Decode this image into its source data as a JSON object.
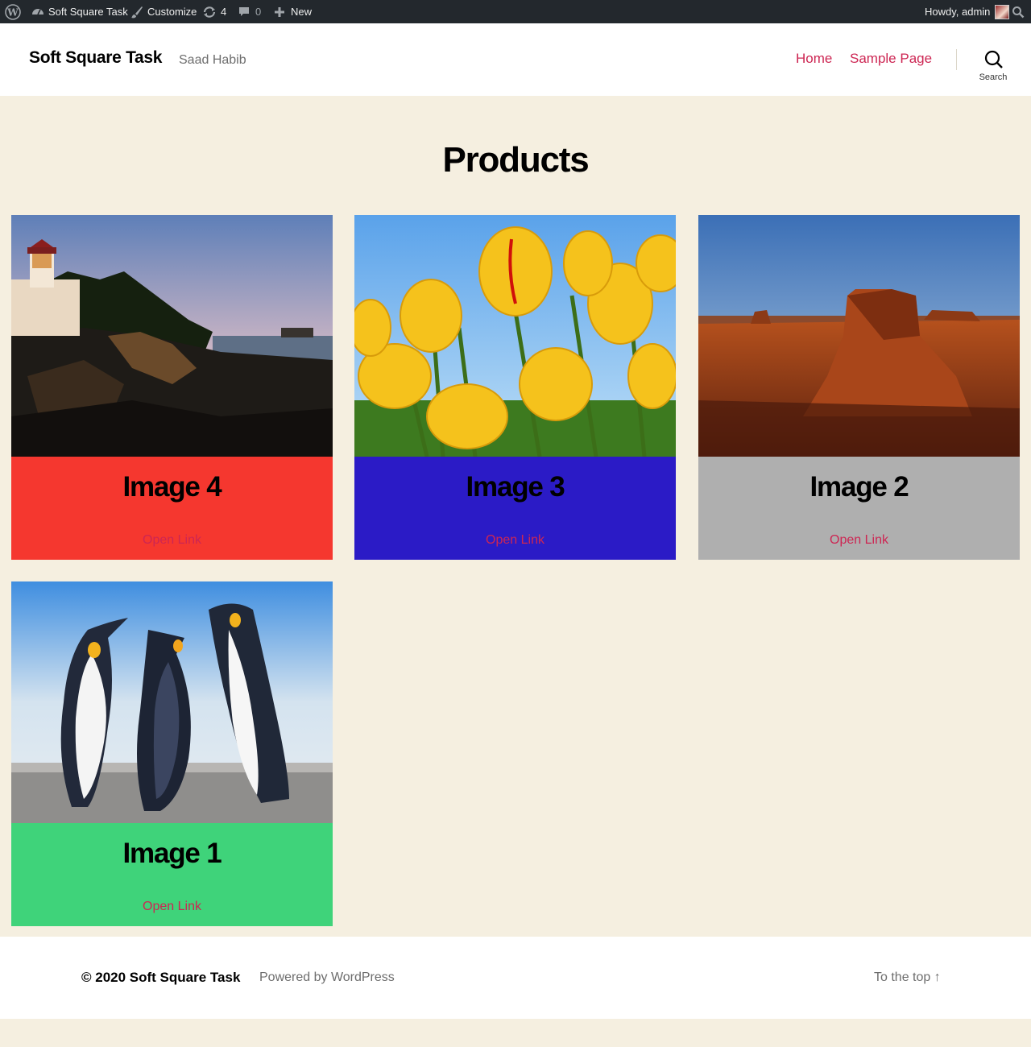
{
  "admin_bar": {
    "site_name": "Soft Square Task",
    "customize": "Customize",
    "updates_count": "4",
    "comments_count": "0",
    "new_label": "New",
    "howdy": "Howdy, admin",
    "icons": [
      "wordpress-logo-icon",
      "dashboard-icon",
      "brush-icon",
      "updates-icon",
      "comment-icon",
      "plus-icon",
      "avatar",
      "search-icon"
    ]
  },
  "header": {
    "site_title": "Soft Square Task",
    "site_description": "Saad Habib",
    "nav": [
      {
        "label": "Home"
      },
      {
        "label": "Sample Page"
      }
    ],
    "search_label": "Search"
  },
  "main": {
    "page_title": "Products",
    "products": [
      {
        "title": "Image 4",
        "link": "Open Link",
        "color": "#f5372f",
        "image": "lighthouse"
      },
      {
        "title": "Image 3",
        "link": "Open Link",
        "color": "#2b1bc6",
        "image": "tulips"
      },
      {
        "title": "Image 2",
        "link": "Open Link",
        "color": "#afafaf",
        "image": "desert"
      },
      {
        "title": "Image 1",
        "link": "Open Link",
        "color": "#3fd37a",
        "image": "penguins"
      }
    ]
  },
  "footer": {
    "copyright": "© 2020 Soft Square Task",
    "powered": "Powered by WordPress",
    "to_top": "To the top ↑"
  },
  "colors": {
    "accent": "#cd2653",
    "background": "#f5efe0",
    "admin_bar": "#23282d"
  }
}
